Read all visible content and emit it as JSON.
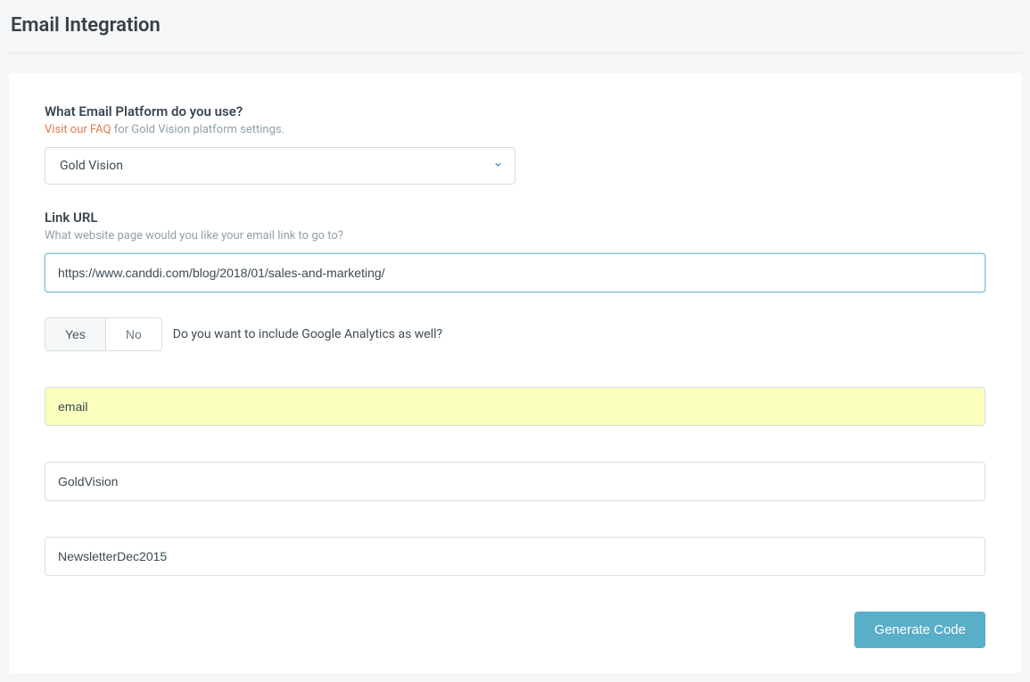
{
  "page": {
    "title": "Email Integration"
  },
  "platform": {
    "label": "What Email Platform do you use?",
    "faq_link_text": "Visit our FAQ",
    "faq_suffix": " for Gold Vision platform settings.",
    "selected": "Gold Vision"
  },
  "link_url": {
    "label": "Link URL",
    "helper": "What website page would you like your email link to go to?",
    "value": "https://www.canddi.com/blog/2018/01/sales-and-marketing/"
  },
  "ga_toggle": {
    "yes": "Yes",
    "no": "No",
    "question": "Do you want to include Google Analytics as well?"
  },
  "fields": {
    "medium": "email",
    "source": "GoldVision",
    "campaign": "NewsletterDec2015"
  },
  "actions": {
    "generate": "Generate Code"
  }
}
